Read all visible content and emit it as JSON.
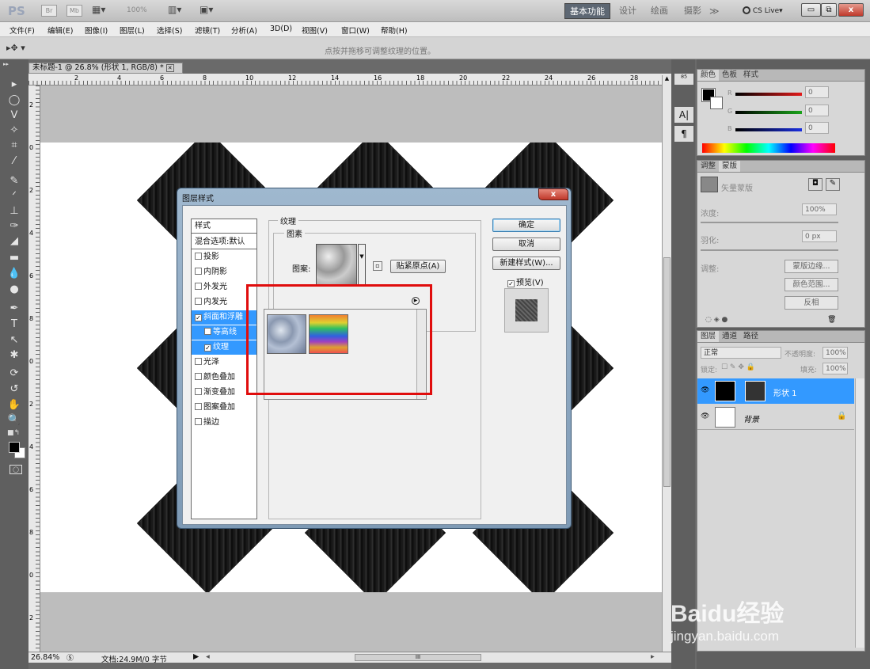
{
  "app": {
    "logo": "PS",
    "br": "Br",
    "mb": "Mb",
    "zoom_menu": "100%",
    "workspaces": [
      "基本功能",
      "设计",
      "绘画",
      "摄影"
    ],
    "more": "≫",
    "cslive": "CS Live▾"
  },
  "menu": [
    "文件(F)",
    "编辑(E)",
    "图像(I)",
    "图层(L)",
    "选择(S)",
    "滤镜(T)",
    "分析(A)",
    "3D(D)",
    "视图(V)",
    "窗口(W)",
    "帮助(H)"
  ],
  "options": {
    "hint": "点按并拖移可调整纹理的位置。"
  },
  "document": {
    "tab": "未标题-1 @ 26.8% (形状 1, RGB/8) *",
    "ruler_h": [
      "2",
      "4",
      "6",
      "8",
      "10",
      "12",
      "14",
      "16",
      "18",
      "20",
      "22",
      "24",
      "26",
      "28"
    ],
    "ruler_v": [
      "2",
      "0",
      "2",
      "4",
      "6",
      "8",
      "0",
      "2",
      "4",
      "6",
      "8",
      "0",
      "2"
    ],
    "zoom": "26.84%",
    "doc_info": "文档:24.9M/0 字节",
    "scroll_mark": "III"
  },
  "dialog": {
    "title": "图层样式",
    "close": "x",
    "styles_header": "样式",
    "blend_options": "混合选项:默认",
    "items": [
      {
        "label": "投影",
        "checked": false
      },
      {
        "label": "内阴影",
        "checked": false
      },
      {
        "label": "外发光",
        "checked": false
      },
      {
        "label": "内发光",
        "checked": false
      },
      {
        "label": "斜面和浮雕",
        "checked": true
      },
      {
        "label": "等高线",
        "checked": false
      },
      {
        "label": "纹理",
        "checked": true
      },
      {
        "label": "光泽",
        "checked": false
      },
      {
        "label": "颜色叠加",
        "checked": false
      },
      {
        "label": "渐变叠加",
        "checked": false
      },
      {
        "label": "图案叠加",
        "checked": false
      },
      {
        "label": "描边",
        "checked": false
      }
    ],
    "section": "纹理",
    "subsection": "图素",
    "pattern_label": "图案:",
    "snap_button": "贴紧原点(A)",
    "ok": "确定",
    "cancel": "取消",
    "new_style": "新建样式(W)...",
    "preview": "预览(V)",
    "preview_check": "✓"
  },
  "color_panel": {
    "tabs": [
      "颜色",
      "色板",
      "样式"
    ],
    "channels": [
      {
        "name": "R",
        "value": "0",
        "color": "#e21a1a"
      },
      {
        "name": "G",
        "value": "0",
        "color": "#19a319"
      },
      {
        "name": "B",
        "value": "0",
        "color": "#1a2fe0"
      }
    ]
  },
  "mask_panel": {
    "tabs": [
      "调整",
      "蒙版"
    ],
    "title": "矢量蒙版",
    "density_label": "浓度:",
    "density": "100%",
    "feather_label": "羽化:",
    "feather": "0 px",
    "adjust_label": "调整:",
    "buttons": [
      "蒙版边缘...",
      "颜色范围...",
      "反相"
    ]
  },
  "layers_panel": {
    "tabs": [
      "图层",
      "通道",
      "路径"
    ],
    "blend": "正常",
    "opacity_label": "不透明度:",
    "opacity": "100%",
    "lock_label": "锁定:",
    "fill_label": "填充:",
    "fill": "100%",
    "layers": [
      {
        "name": "形状 1",
        "selected": true
      },
      {
        "name": "背景",
        "selected": false
      }
    ]
  },
  "watermark": {
    "text": "Baidu经验",
    "url": "jingyan.baidu.com"
  }
}
